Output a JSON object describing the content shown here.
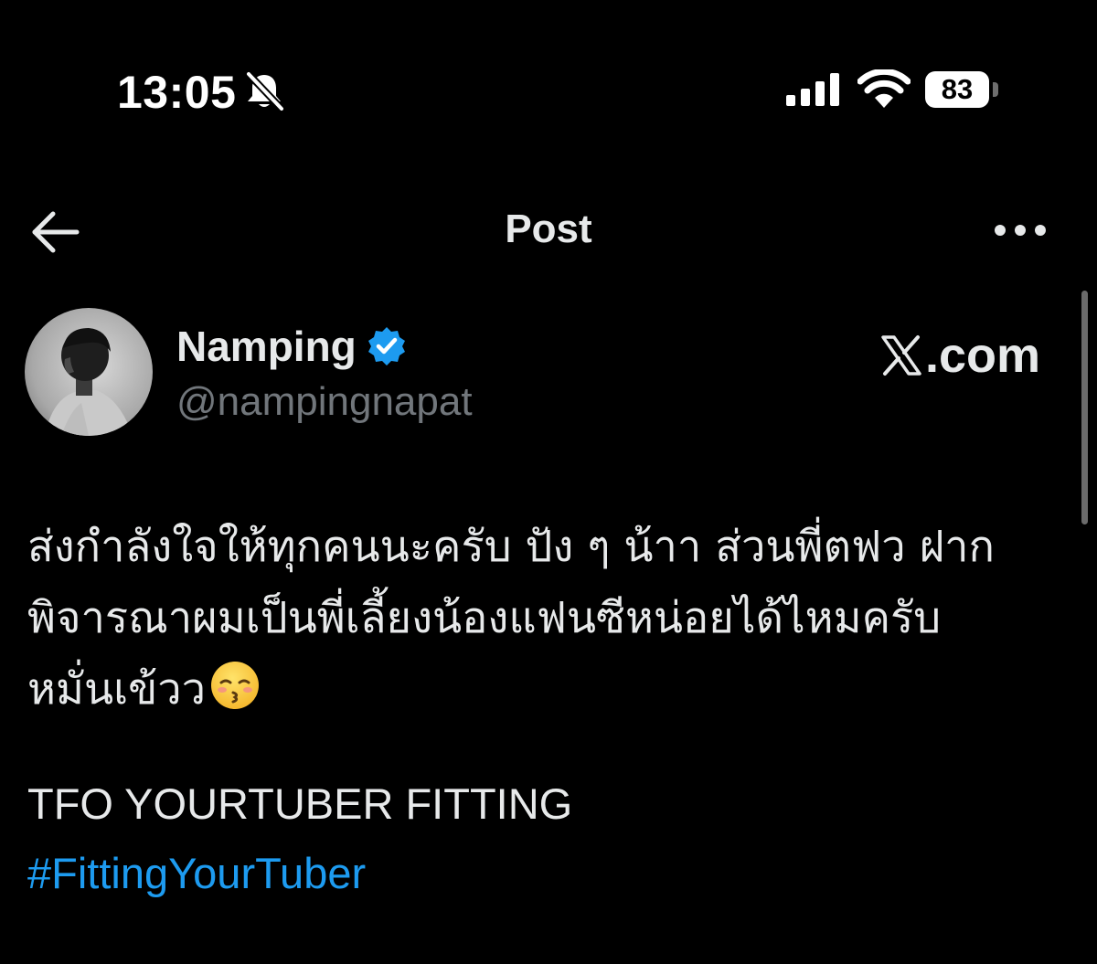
{
  "status_bar": {
    "time": "13:05",
    "battery": "83",
    "icons": [
      "bell-slash-icon",
      "cellular-signal-icon",
      "wifi-icon",
      "battery-icon"
    ]
  },
  "header": {
    "title": "Post",
    "back_icon": "arrow-left-icon",
    "more_icon": "more-horizontal-icon"
  },
  "author": {
    "name": "Namping",
    "handle": "@nampingnapat",
    "verified": true,
    "verified_color": "#1d9bf0"
  },
  "watermark": {
    "logo": "x-logo-icon",
    "text": ".com"
  },
  "post": {
    "lines": [
      "ส่งกำลังใจให้ทุกคนนะครับ ปัง ๆ น้าา ส่วนพี่ตฟว ฝาก",
      "พิจารณาผมเป็นพี่เลี้ยงน้องแฟนซีหน่อยได้ไหมครับ",
      "หมั่นเข้วว"
    ],
    "emoji": "kissing-face-closed-eyes-emoji",
    "title": "TFO YOURTUBER FITTING",
    "hashtag": "#FittingYourTuber"
  },
  "colors": {
    "background": "#000000",
    "text": "#e7e9ea",
    "secondary": "#71767b",
    "link": "#1d9bf0"
  }
}
